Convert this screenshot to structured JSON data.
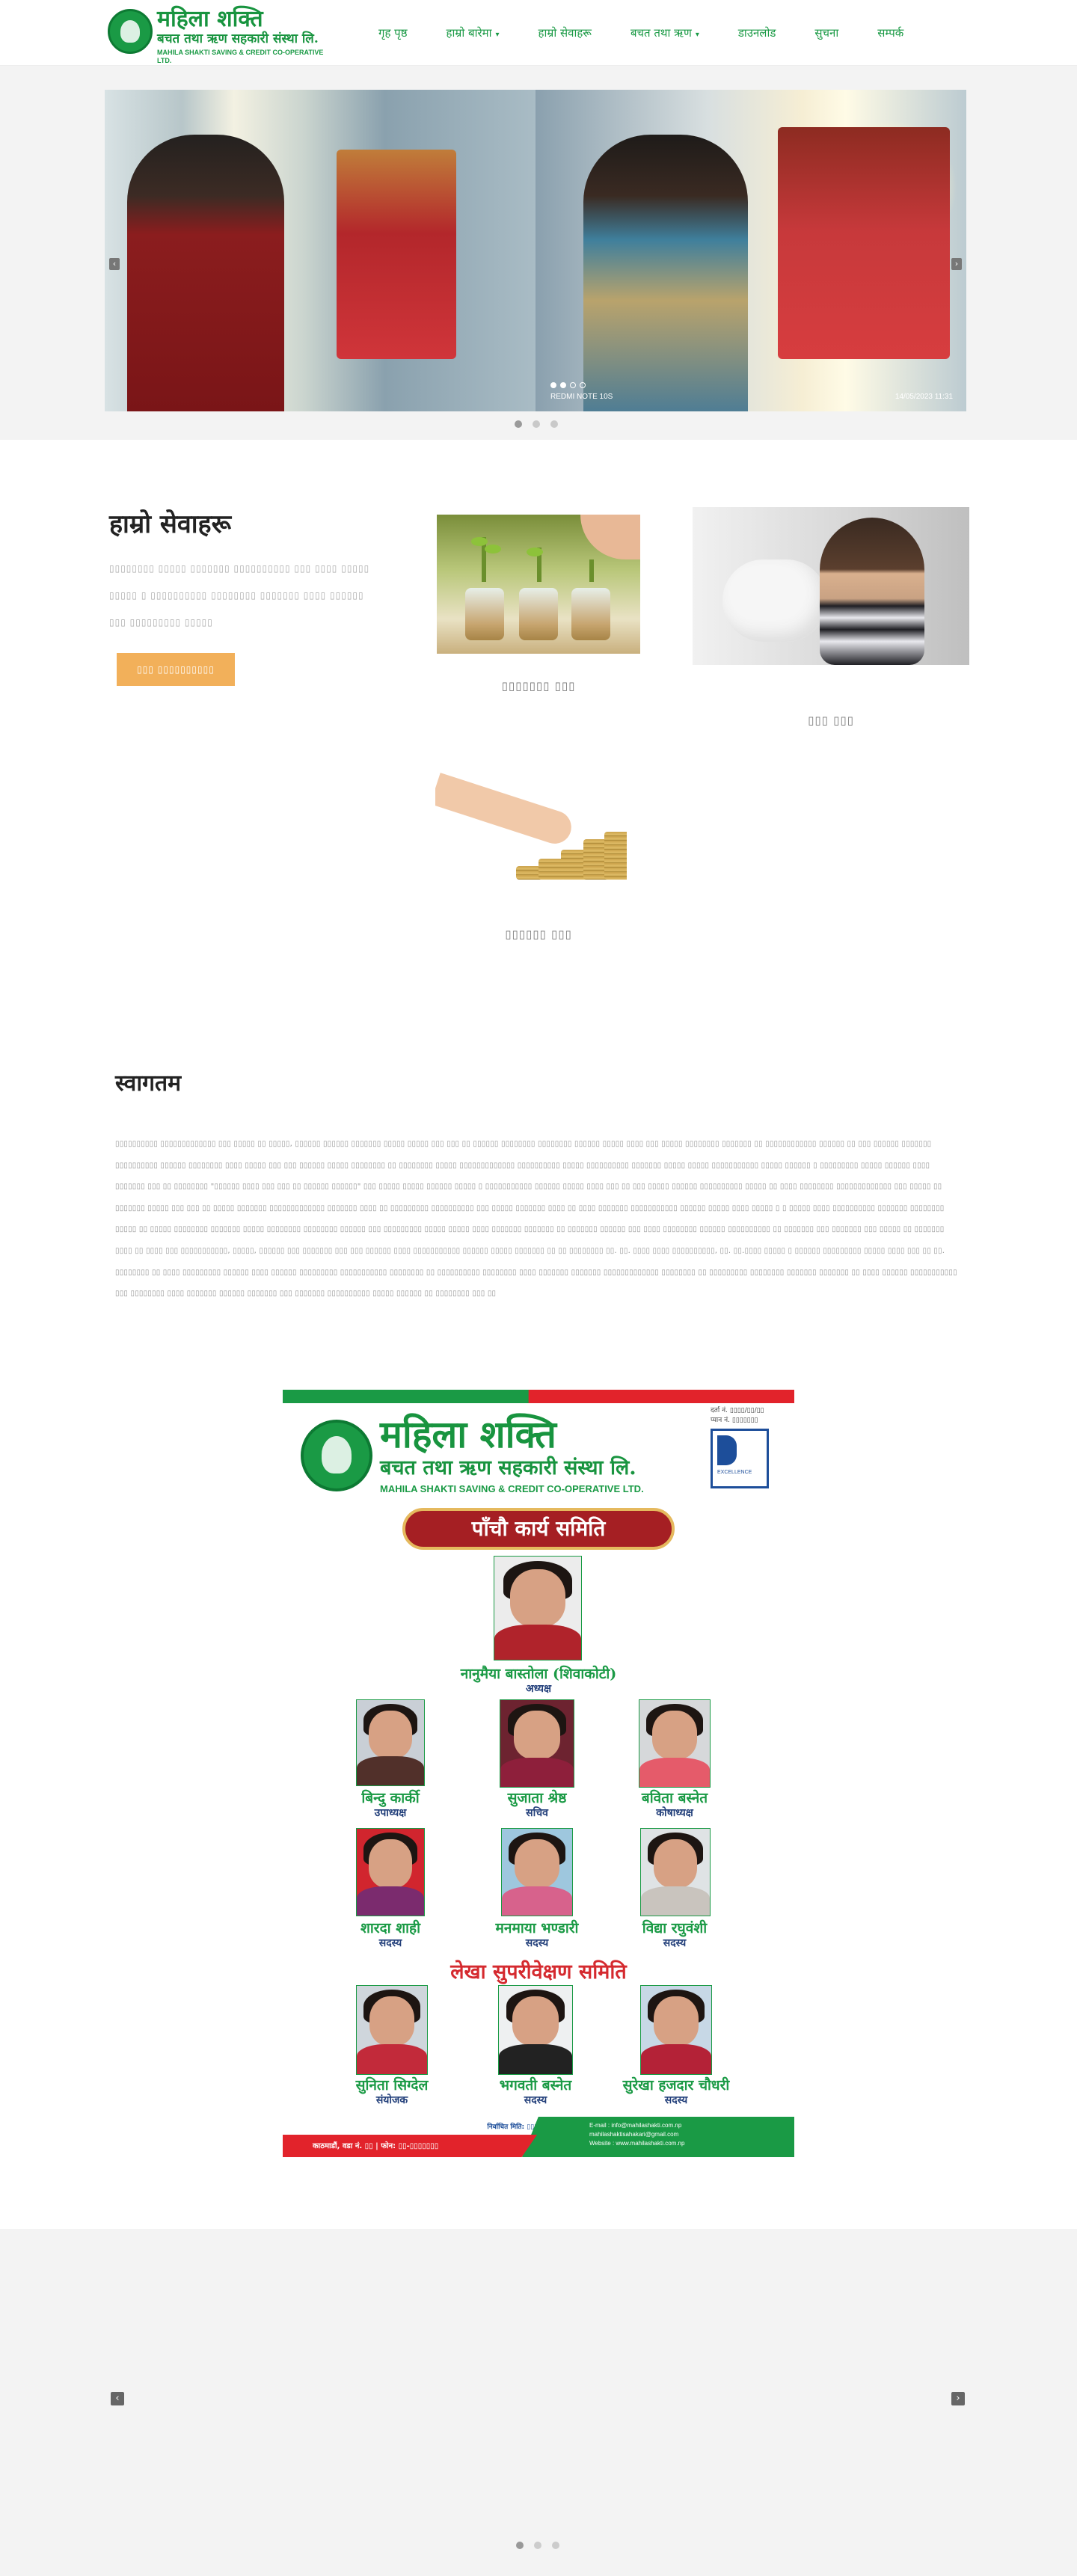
{
  "logo": {
    "title": "महिला शक्ति",
    "subtitle": "बचत तथा ऋण सहकारी संस्था लि.",
    "english": "MAHILA SHAKTI SAVING & CREDIT CO-OPERATIVE LTD."
  },
  "nav": {
    "items": [
      {
        "label": "गृह पृष्ठ"
      },
      {
        "label": "हाम्रो बारेमा",
        "caret": "▾"
      },
      {
        "label": "हाम्रो सेवाहरू"
      },
      {
        "label": "बचत तथा ऋण",
        "caret": "▾"
      },
      {
        "label": "डाउनलोड"
      },
      {
        "label": "सुचना"
      },
      {
        "label": "सम्पर्क"
      }
    ]
  },
  "hero": {
    "camera": "REDMI NOTE 10S",
    "date": "14/05/2023 11:31",
    "prev": "‹",
    "next": "›"
  },
  "services": {
    "title": "हाम्रो सेवाहरू",
    "description": "▯▯▯▯▯▯▯▯ ▯▯▯▯▯ ▯▯▯▯▯▯▯ ▯▯▯▯▯▯▯▯▯▯ ▯▯▯ ▯▯▯▯ ▯▯▯▯▯ ▯▯▯▯▯ ▯ ▯▯▯▯▯▯▯▯▯▯ ▯▯▯▯▯▯▯▯ ▯▯▯▯▯▯▯ ▯▯▯▯ ▯▯▯▯▯▯ ▯▯▯ ▯▯▯▯▯▯▯▯▯ ▯▯▯▯▯",
    "button": "▯▯▯ ▯▯▯▯▯▯▯▯▯▯",
    "cards": [
      {
        "label": "▯▯▯▯▯▯▯ ▯▯▯"
      },
      {
        "label": "▯▯▯ ▯▯▯"
      },
      {
        "label": "▯▯▯▯▯▯ ▯▯▯"
      }
    ]
  },
  "welcome": {
    "title": "स्वागतम",
    "body": "▯▯▯▯▯▯▯▯▯▯ ▯▯▯▯▯▯▯▯▯▯▯▯▯ ▯▯▯ ▯▯▯▯▯ ▯▯ ▯▯▯▯▯, ▯▯▯▯▯▯ ▯▯▯▯▯▯ ▯▯▯▯▯▯▯ ▯▯▯▯▯ ▯▯▯▯▯ ▯▯▯ ▯▯▯ ▯▯ ▯▯▯▯▯▯ ▯▯▯▯▯▯▯▯ ▯▯▯▯▯▯▯▯ ▯▯▯▯▯▯ ▯▯▯▯▯ ▯▯▯▯ ▯▯▯ ▯▯▯▯▯ ▯▯▯▯▯▯▯▯ ▯▯▯▯▯▯▯ ▯▯ ▯▯▯▯▯▯▯▯▯▯▯▯ ▯▯▯▯▯▯ ▯▯ ▯▯▯ ▯▯▯▯▯▯ ▯▯▯▯▯▯▯ ▯▯▯▯▯▯▯▯▯▯ ▯▯▯▯▯▯ ▯▯▯▯▯▯▯▯ ▯▯▯▯ ▯▯▯▯▯ ▯▯▯ ▯▯▯ ▯▯▯▯▯▯ ▯▯▯▯▯ ▯▯▯▯▯▯▯▯ ▯▯ ▯▯▯▯▯▯▯▯ ▯▯▯▯▯ ▯▯▯▯▯▯▯▯▯▯▯▯▯ ▯▯▯▯▯▯▯▯▯▯ ▯▯▯▯▯ ▯▯▯▯▯▯▯▯▯▯ ▯▯▯▯▯▯▯ ▯▯▯▯▯ ▯▯▯▯▯ ▯▯▯▯▯▯▯▯▯▯▯ ▯▯▯▯▯ ▯▯▯▯▯▯ ▯ ▯▯▯▯▯▯▯▯▯ ▯▯▯▯▯ ▯▯▯▯▯▯ ▯▯▯▯ ▯▯▯▯▯▯▯ ▯▯▯ ▯▯ ▯▯▯▯▯▯▯▯ \"▯▯▯▯▯▯ ▯▯▯▯ ▯▯▯ ▯▯▯ ▯▯ ▯▯▯▯▯▯ ▯▯▯▯▯▯\" ▯▯▯ ▯▯▯▯▯ ▯▯▯▯▯ ▯▯▯▯▯▯ ▯▯▯▯▯ ▯ ▯▯▯▯▯▯▯▯▯▯▯ ▯▯▯▯▯▯ ▯▯▯▯▯ ▯▯▯▯ ▯▯▯ ▯▯ ▯▯▯ ▯▯▯▯▯ ▯▯▯▯▯▯ ▯▯▯▯▯▯▯▯▯▯ ▯▯▯▯▯ ▯▯ ▯▯▯▯ ▯▯▯▯▯▯▯▯ ▯▯▯▯▯▯▯▯▯▯▯▯▯ ▯▯▯ ▯▯▯▯▯ ▯▯ ▯▯▯▯▯▯▯ ▯▯▯▯▯ ▯▯▯ ▯▯▯ ▯▯ ▯▯▯▯▯ ▯▯▯▯▯▯▯ ▯▯▯▯▯▯▯▯▯▯▯▯▯ ▯▯▯▯▯▯▯ ▯▯▯▯ ▯▯ ▯▯▯▯▯▯▯▯▯ ▯▯▯▯▯▯▯▯▯▯ ▯▯▯ ▯▯▯▯▯ ▯▯▯▯▯▯▯ ▯▯▯▯ ▯▯ ▯▯▯▯ ▯▯▯▯▯▯▯ ▯▯▯▯▯▯▯▯▯▯▯ ▯▯▯▯▯▯ ▯▯▯▯▯ ▯▯▯▯ ▯▯▯▯▯ ▯ ▯ ▯▯▯▯▯ ▯▯▯▯ ▯▯▯▯▯▯▯▯▯▯ ▯▯▯▯▯▯▯ ▯▯▯▯▯▯▯▯ ▯▯▯▯▯ ▯▯ ▯▯▯▯▯ ▯▯▯▯▯▯▯▯ ▯▯▯▯▯▯▯ ▯▯▯▯▯ ▯▯▯▯▯▯▯▯ ▯▯▯▯▯▯▯▯ ▯▯▯▯▯▯ ▯▯▯ ▯▯▯▯▯▯▯▯▯ ▯▯▯▯▯ ▯▯▯▯▯ ▯▯▯▯ ▯▯▯▯▯▯▯ ▯▯▯▯▯▯▯ ▯▯ ▯▯▯▯▯▯▯ ▯▯▯▯▯▯ ▯▯▯ ▯▯▯▯ ▯▯▯▯▯▯▯▯ ▯▯▯▯▯▯ ▯▯▯▯▯▯▯▯▯▯ ▯▯ ▯▯▯▯▯▯▯ ▯▯▯ ▯▯▯▯▯▯▯ ▯▯▯ ▯▯▯▯▯ ▯▯ ▯▯▯▯▯▯▯ ▯▯▯▯ ▯▯ ▯▯▯▯ ▯▯▯ ▯▯▯▯▯▯▯▯▯▯▯, ▯▯▯▯▯, ▯▯▯▯▯▯ ▯▯▯ ▯▯▯▯▯▯▯ ▯▯▯ ▯▯▯ ▯▯▯▯▯▯ ▯▯▯▯ ▯▯▯▯▯▯▯▯▯▯▯ ▯▯▯▯▯▯ ▯▯▯▯▯ ▯▯▯▯▯▯▯ ▯▯ ▯▯ ▯▯▯▯▯▯▯▯ ▯▯. ▯▯. ▯▯▯▯ ▯▯▯▯ ▯▯▯▯▯▯▯▯▯▯, ▯▯. ▯▯.▯▯▯▯ ▯▯▯▯▯ ▯ ▯▯▯▯▯▯ ▯▯▯▯▯▯▯▯▯ ▯▯▯▯▯ ▯▯▯▯ ▯▯▯ ▯▯ ▯▯. ▯▯▯▯▯▯▯▯ ▯▯ ▯▯▯▯ ▯▯▯▯▯▯▯▯▯ ▯▯▯▯▯▯ ▯▯▯▯ ▯▯▯▯▯▯ ▯▯▯▯▯▯▯▯▯ ▯▯▯▯▯▯▯▯▯▯▯ ▯▯▯▯▯▯▯▯ ▯▯ ▯▯▯▯▯▯▯▯▯▯ ▯▯▯▯▯▯▯▯ ▯▯▯▯ ▯▯▯▯▯▯▯ ▯▯▯▯▯▯▯ ▯▯▯▯▯▯▯▯▯▯▯▯▯ ▯▯▯▯▯▯▯▯ ▯▯ ▯▯▯▯▯▯▯▯▯ ▯▯▯▯▯▯▯▯ ▯▯▯▯▯▯▯ ▯▯▯▯▯▯▯ ▯▯ ▯▯▯▯ ▯▯▯▯▯▯ ▯▯▯▯▯▯▯▯▯▯▯ ▯▯▯ ▯▯▯▯▯▯▯▯ ▯▯▯▯ ▯▯▯▯▯▯▯ ▯▯▯▯▯▯ ▯▯▯▯▯▯▯ ▯▯▯ ▯▯▯▯▯▯▯ ▯▯▯▯▯▯▯▯▯▯ ▯▯▯▯▯ ▯▯▯▯▯▯ ▯▯ ▯▯▯▯▯▯▯▯ ▯▯▯ ▯▯"
  },
  "poster": {
    "title": "महिला शक्ति",
    "subtitle": "बचत तथा ऋण सहकारी संस्था लि.",
    "english": "MAHILA SHAKTI SAVING & CREDIT CO-OPERATIVE LTD.",
    "reg": "दर्ता नं. ▯▯▯▯/▯▯/▯▯\nप्यान नं. ▯▯▯▯▯▯▯",
    "seal": "EXCELLENCE",
    "banner": "पाँचौ कार्य समिति",
    "section2": "लेखा सुपरीवेक्षण समिति",
    "members": [
      {
        "name": "नानुमैया बास्तोला (शिवाकोटी)",
        "role": "अध्यक्ष"
      },
      {
        "name": "बिन्दु कार्की",
        "role": "उपाध्यक्ष"
      },
      {
        "name": "सुजाता श्रेष्ठ",
        "role": "सचिव"
      },
      {
        "name": "बविता बस्नेत",
        "role": "कोषाध्यक्ष"
      },
      {
        "name": "शारदा शाही",
        "role": "सदस्य"
      },
      {
        "name": "मनमाया भण्डारी",
        "role": "सदस्य"
      },
      {
        "name": "विद्या रघुवंशी",
        "role": "सदस्य"
      },
      {
        "name": "सुनिता सिग्देल",
        "role": "संयोजक"
      },
      {
        "name": "भगवती बस्नेत",
        "role": "सदस्य"
      },
      {
        "name": "सुरेखा हजदार चौधरी",
        "role": "सदस्य"
      }
    ],
    "meeting": "निर्वाचित मिति: ▯▯▯▯ पौष ▯▯ गते सम्पन्न",
    "address": "काठमाडौं, वडा नं. ▯▯ | फोन: ▯▯-▯▯▯▯▯▯▯",
    "contact": "E-mail : info@mahilashakti.com.np\nmahilashaktisahakari@gmail.com\nWebsite : www.mahilashakti.com.np"
  },
  "bottom": {
    "prev": "‹",
    "next": "›"
  }
}
